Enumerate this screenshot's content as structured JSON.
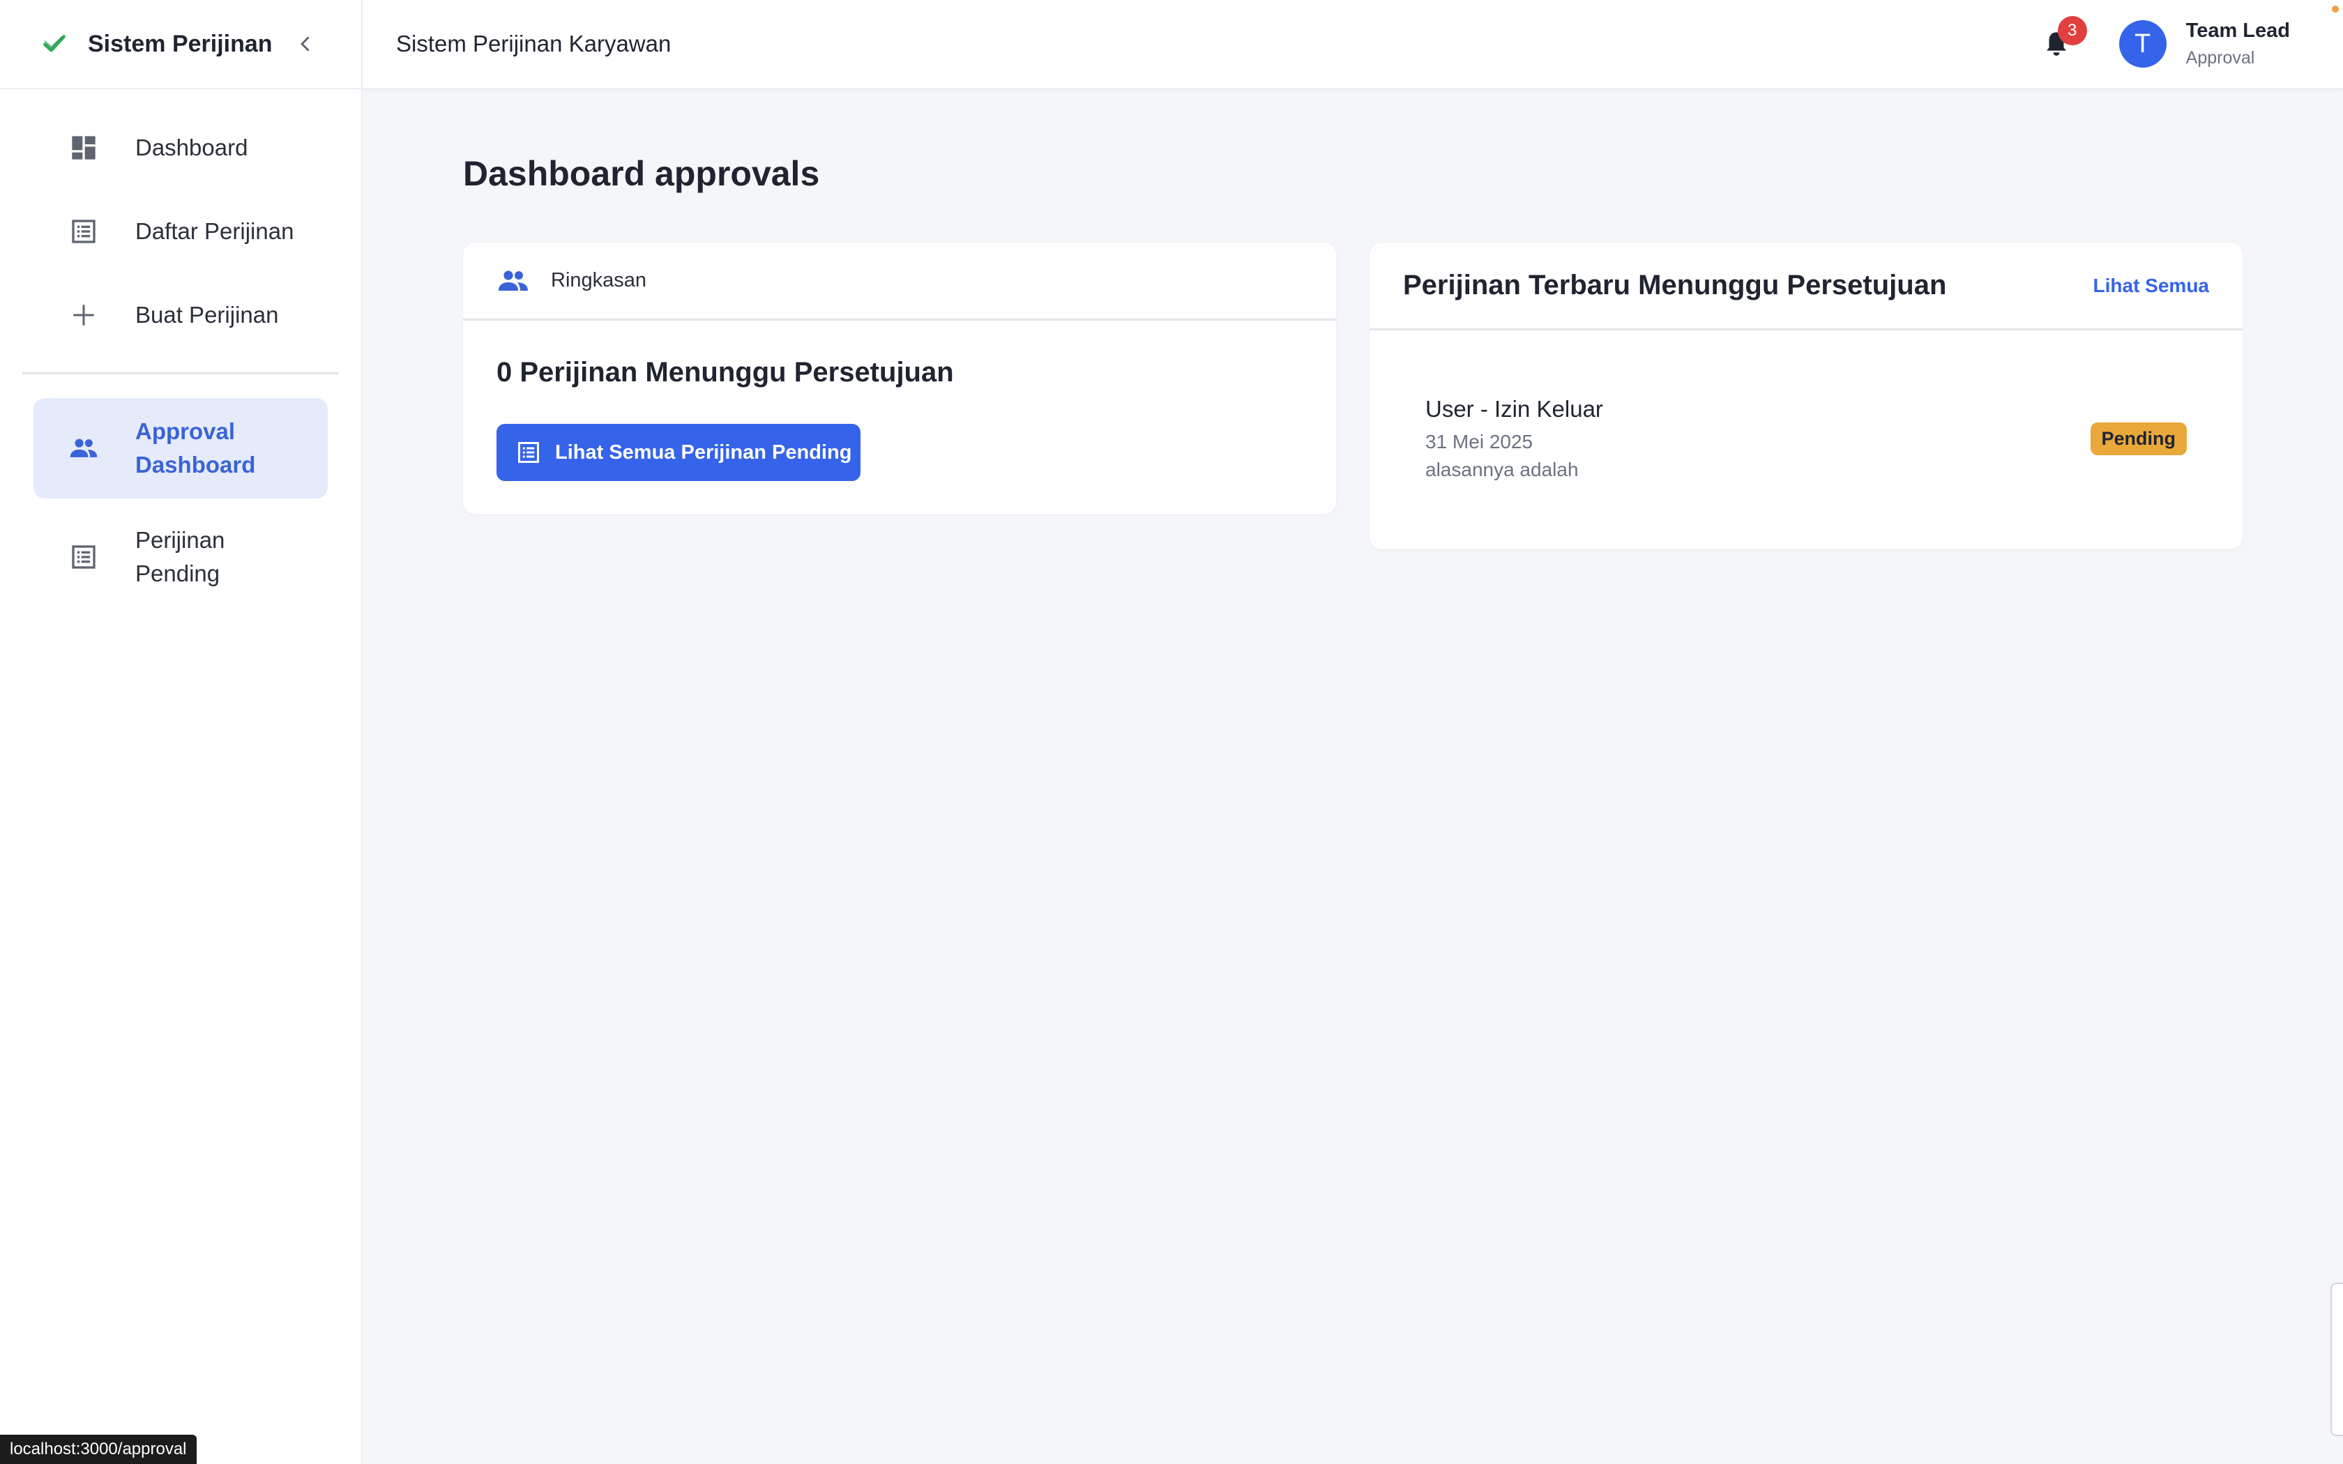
{
  "sidebar": {
    "brand": "Sistem Perijinan",
    "items": [
      {
        "label": "Dashboard"
      },
      {
        "label": "Daftar Perijinan"
      },
      {
        "label": "Buat Perijinan"
      },
      {
        "label": "Approval Dashboard",
        "active": true
      },
      {
        "label": "Perijinan Pending"
      }
    ]
  },
  "header": {
    "title": "Sistem Perijinan Karyawan",
    "notification_count": "3",
    "user": {
      "initial": "T",
      "name": "Team Lead",
      "role": "Approval"
    }
  },
  "main": {
    "page_title": "Dashboard approvals",
    "summary_card": {
      "header_label": "Ringkasan",
      "summary_text": "0 Perijinan Menunggu Persetujuan",
      "button_label": "Lihat Semua Perijinan Pending"
    },
    "recent_card": {
      "title": "Perijinan Terbaru Menunggu Persetujuan",
      "link_label": "Lihat Semua",
      "items": [
        {
          "title": "User - Izin Keluar",
          "date": "31 Mei 2025",
          "reason": "alasannya adalah",
          "status": "Pending"
        }
      ]
    }
  },
  "statusbar": {
    "url": "localhost:3000/approval"
  },
  "colors": {
    "primary": "#3563e9",
    "pending": "#eaa83a",
    "badge": "#e0413e",
    "brand_check": "#2eaa57"
  }
}
